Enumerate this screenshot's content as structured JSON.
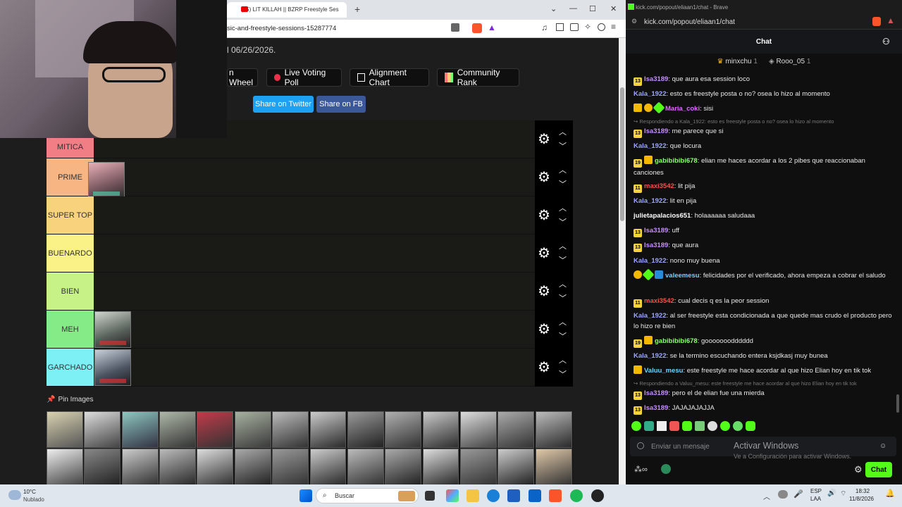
{
  "left_browser": {
    "tab_title": "(35) LIT KILLAH || BZRP Freestyle Ses",
    "new_tab": "+",
    "url_fragment": "sic-and-freestyle-sessions-15287774",
    "window_min": "⌄",
    "window_restore": "—",
    "window_max": "☐",
    "window_close": "✕"
  },
  "tierlist": {
    "date_text": "l 06/26/2026.",
    "tool_buttons": [
      {
        "label": "n Wheel"
      },
      {
        "label": "Live Voting Poll"
      },
      {
        "label": "Alignment Chart"
      },
      {
        "label": "Community Rank"
      }
    ],
    "share_twitter": "Share on Twitter",
    "share_fb": "Share on FB",
    "tiers": [
      {
        "label": "MITICA",
        "color": "#f07e84"
      },
      {
        "label": "PRIME",
        "color": "#f6b582"
      },
      {
        "label": "SUPER TOP",
        "color": "#f8d27c"
      },
      {
        "label": "BUENARDO",
        "color": "#fbf287"
      },
      {
        "label": "BIEN",
        "color": "#c6f288"
      },
      {
        "label": "MEH",
        "color": "#85eb86"
      },
      {
        "label": "GARCHADO",
        "color": "#7cf0f4"
      }
    ],
    "pin_images_label": "Pin Images",
    "pin_icon": "pushpin-icon"
  },
  "chat_browser": {
    "title": "kick.com/popout/eliaan1/chat - Brave",
    "url": "kick.com/popout/eliaan1/chat",
    "header": "Chat",
    "pinned_users": [
      {
        "name": "minxchu",
        "count": "1"
      },
      {
        "name": "Rooo_05",
        "count": "1"
      }
    ],
    "messages": [
      {
        "user": "Isa3189",
        "color": "#c48cff",
        "text": ": que aura esa session loco",
        "badges": [
          "13"
        ]
      },
      {
        "user": "Kala_1922",
        "color": "#9ba6ff",
        "text": ": esto es freestyle posta o no? osea lo hizo al momento",
        "badges": []
      },
      {
        "user": "Maria_coki",
        "color": "#e06cff",
        "text": ": sisi",
        "badges": [
          "crown",
          "coin",
          "gem"
        ]
      },
      {
        "reply": "Respondiendo a Kala_1922: esto es freestyle posta o no? osea lo hizo al momento"
      },
      {
        "user": "Isa3189",
        "color": "#c48cff",
        "text": ": me parece que si",
        "badges": [
          "13"
        ]
      },
      {
        "user": "Kala_1922",
        "color": "#9ba6ff",
        "text": ": que locura",
        "badges": []
      },
      {
        "user": "gabibibibi678",
        "color": "#8cff6a",
        "text": ": elian me haces acordar a los 2 pibes que reaccionaban canciones",
        "badges": [
          "19",
          "crown"
        ]
      },
      {
        "user": "maxi3542",
        "color": "#ff4d4d",
        "text": ": lit pija",
        "badges": [
          "11"
        ]
      },
      {
        "user": "Kala_1922",
        "color": "#9ba6ff",
        "text": ": lit en pija",
        "badges": []
      },
      {
        "user": "julietapalacios651",
        "color": "#ffffff",
        "text": ": holaaaaaa saludaaa",
        "badges": []
      },
      {
        "user": "Isa3189",
        "color": "#c48cff",
        "text": ": uff",
        "badges": [
          "13"
        ]
      },
      {
        "user": "Isa3189",
        "color": "#c48cff",
        "text": ": que aura",
        "badges": [
          "13"
        ]
      },
      {
        "user": "Kala_1922",
        "color": "#9ba6ff",
        "text": ": nono muy buena",
        "badges": []
      },
      {
        "user": "valeemesu",
        "color": "#6cd3ff",
        "text": ": felicidades por el verificado, ahora empeza a cobrar el saludo",
        "badges": [
          "coin",
          "gem",
          "verified"
        ]
      },
      {
        "user": "maxi3542",
        "color": "#ff4d4d",
        "text": ": cual decis q es la peor session",
        "badges": [
          "11"
        ]
      },
      {
        "user": "Kala_1922",
        "color": "#9ba6ff",
        "text": ": al ser freestyle esta condicionada a que quede mas crudo el producto pero lo hizo re bien",
        "badges": []
      },
      {
        "user": "gabibibibi678",
        "color": "#8cff6a",
        "text": ": gooooooodddddd",
        "badges": [
          "19",
          "crown"
        ]
      },
      {
        "user": "Kala_1922",
        "color": "#9ba6ff",
        "text": ": se la termino escuchando entera ksjdkasj muy bunea",
        "badges": []
      },
      {
        "user": "Valuu_mesu",
        "color": "#6cd3ff",
        "text": ": este freestyle me hace acordar al que hizo Elian hoy en tik tok",
        "badges": [
          "crown"
        ]
      },
      {
        "reply": "Respondiendo a Valuu_mesu: este freestyle me hace acordar al que hizo Elian hoy en tik tok"
      },
      {
        "user": "Isa3189",
        "color": "#c48cff",
        "text": ": pero el de elian fue una mierda",
        "badges": [
          "13"
        ]
      },
      {
        "user": "Isa3189",
        "color": "#c48cff",
        "text": ": JAJAJAJAJJA",
        "badges": [
          "13"
        ]
      }
    ],
    "input_placeholder": "Enviar un mensaje",
    "activate_title": "Activar Windows",
    "activate_sub": "Ve a Configuración para activar Windows.",
    "send_label": "Chat"
  },
  "taskbar": {
    "weather_temp": "10°C",
    "weather_desc": "Nublado",
    "search_label": "Buscar",
    "lang": "ESP",
    "lang_sub": "LAA",
    "time": "18:32",
    "date": "11/8/2026"
  }
}
